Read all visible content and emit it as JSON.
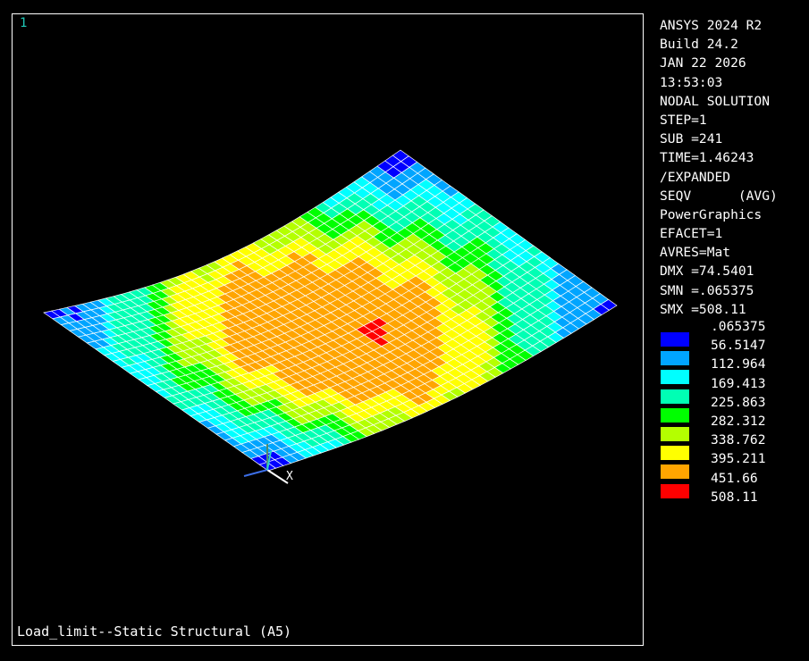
{
  "window": {
    "number": "1"
  },
  "header": [
    "ANSYS 2024 R2",
    "Build 24.2",
    "JAN 22 2026",
    "13:53:03",
    "NODAL SOLUTION",
    "STEP=1",
    "SUB =241",
    "TIME=1.46243",
    "/EXPANDED",
    "SEQV      (AVG)",
    "PowerGraphics",
    "EFACET=1",
    "AVRES=Mat",
    "DMX =74.5401",
    "SMN =.065375",
    "SMX =508.11"
  ],
  "legend": {
    "values": [
      ".065375",
      "56.5147",
      "112.964",
      "169.413",
      "225.863",
      "282.312",
      "338.762",
      "395.211",
      "451.66",
      "508.11"
    ],
    "colors": [
      "#0000ff",
      "#00a5ff",
      "#00ffff",
      "#00ffb4",
      "#00ff00",
      "#b4ff00",
      "#ffff00",
      "#ffa500",
      "#ff0000"
    ]
  },
  "triad": {
    "x_label": "X"
  },
  "footer": {
    "jobname": "Load_limit--Static Structural (A5)"
  }
}
